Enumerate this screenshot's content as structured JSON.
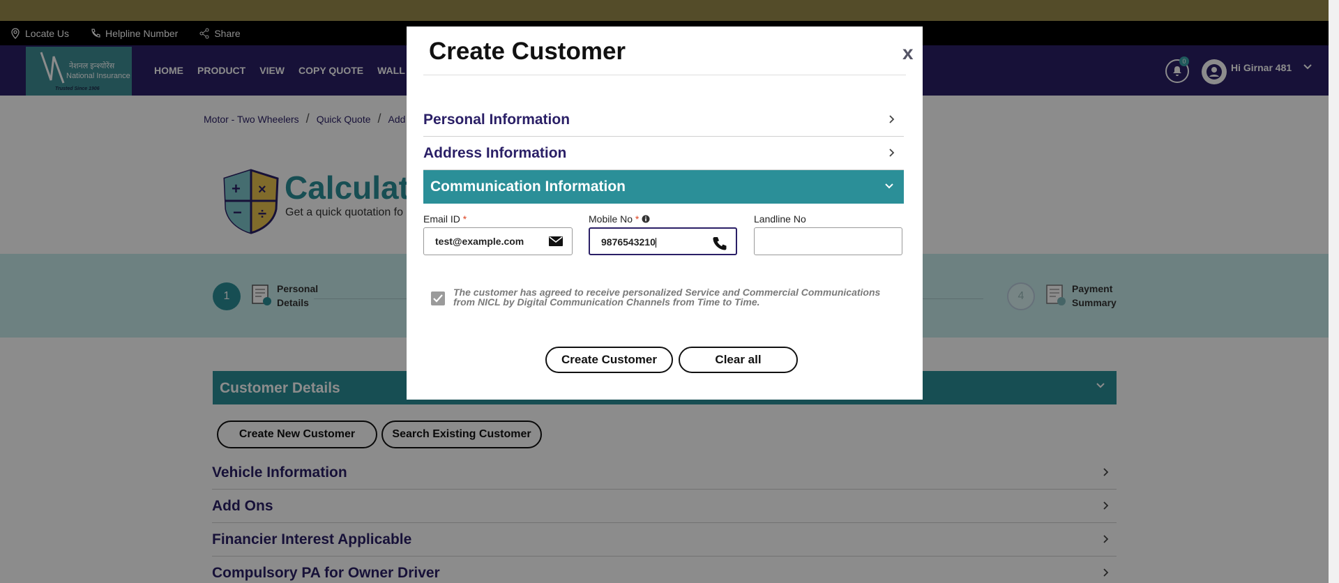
{
  "utility_bar": {
    "locate_us": "Locate Us",
    "helpline": "Helpline Number",
    "share": "Share"
  },
  "brand": {
    "name_hindi": "नेशनल इन्श्योरेंस",
    "name_en": "National Insurance",
    "tagline": "Trusted Since 1906"
  },
  "nav": {
    "items": [
      "HOME",
      "PRODUCT",
      "VIEW",
      "COPY QUOTE",
      "WALL"
    ],
    "notification_count": "0",
    "user_greeting": "Hi Girnar 481"
  },
  "breadcrumb": [
    "Motor - Two Wheelers",
    "Quick Quote",
    "Add"
  ],
  "hero": {
    "title": "Calculate",
    "subtitle": "Get a quick quotation fo"
  },
  "stepper": {
    "step1_number": "1",
    "step1_line1": "Personal",
    "step1_line2": "Details",
    "step4_number": "4",
    "step4_line1": "Payment",
    "step4_line2": "Summary"
  },
  "customer_details": {
    "title": "Customer Details",
    "create_new": "Create New Customer",
    "search_existing": "Search Existing Customer"
  },
  "sections": [
    "Vehicle Information",
    "Add Ons",
    "Financier Interest Applicable",
    "Compulsory PA for Owner Driver"
  ],
  "modal": {
    "title": "Create Customer",
    "close": "x",
    "accordion_personal": "Personal Information",
    "accordion_address": "Address Information",
    "accordion_communication": "Communication Information",
    "email_label": "Email ID",
    "email_value": "test@example.com",
    "mobile_label": "Mobile No",
    "mobile_value": "9876543210",
    "landline_label": "Landline No",
    "landline_value": "",
    "required_mark": "*",
    "consent_text": "The customer has agreed to receive personalized Service and Commercial Communications from NICL by Digital Communication Channels from Time to Time.",
    "create_button": "Create Customer",
    "clear_button": "Clear all"
  },
  "colors": {
    "navy": "#2a1f66",
    "teal": "#2b8f98",
    "gold_bar": "#9a8a4c",
    "stepper_band": "#c6ebec"
  }
}
